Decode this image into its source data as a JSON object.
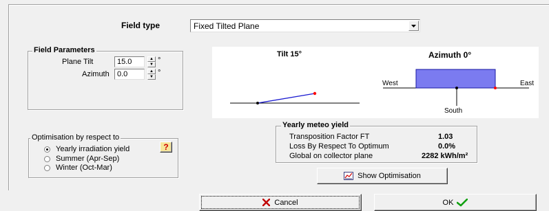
{
  "field_type": {
    "label": "Field type",
    "selected": "Fixed Tilted Plane"
  },
  "field_parameters": {
    "title": "Field Parameters",
    "plane_tilt_label": "Plane Tilt",
    "plane_tilt_value": "15.0",
    "plane_tilt_unit": "°",
    "azimuth_label": "Azimuth",
    "azimuth_value": "0.0",
    "azimuth_unit": "°"
  },
  "diagram": {
    "tilt_title": "Tilt 15°",
    "azimuth_title": "Azimuth 0°",
    "west": "West",
    "east": "East",
    "south": "South",
    "plane_color": "#7b7bf0",
    "tilt_line_color": "#1a1ad0",
    "marker_color": "#ff0000"
  },
  "yearly_meteo": {
    "title": "Yearly meteo yield",
    "rows": [
      {
        "label": "Transposition Factor FT",
        "value": "1.03"
      },
      {
        "label": "Loss By Respect To Optimum",
        "value": "0.0%"
      },
      {
        "label": "Global on collector plane",
        "value": "2282 kWh/m²"
      }
    ]
  },
  "optimisation": {
    "title": "Optimisation by respect to",
    "options": [
      {
        "label": "Yearly irradiation yield",
        "selected": true
      },
      {
        "label": "Summer (Apr-Sep)",
        "selected": false
      },
      {
        "label": "Winter (Oct-Mar)",
        "selected": false
      }
    ],
    "help_glyph": "?"
  },
  "buttons": {
    "show_optimisation": "Show Optimisation",
    "cancel": "Cancel",
    "ok": "OK"
  }
}
